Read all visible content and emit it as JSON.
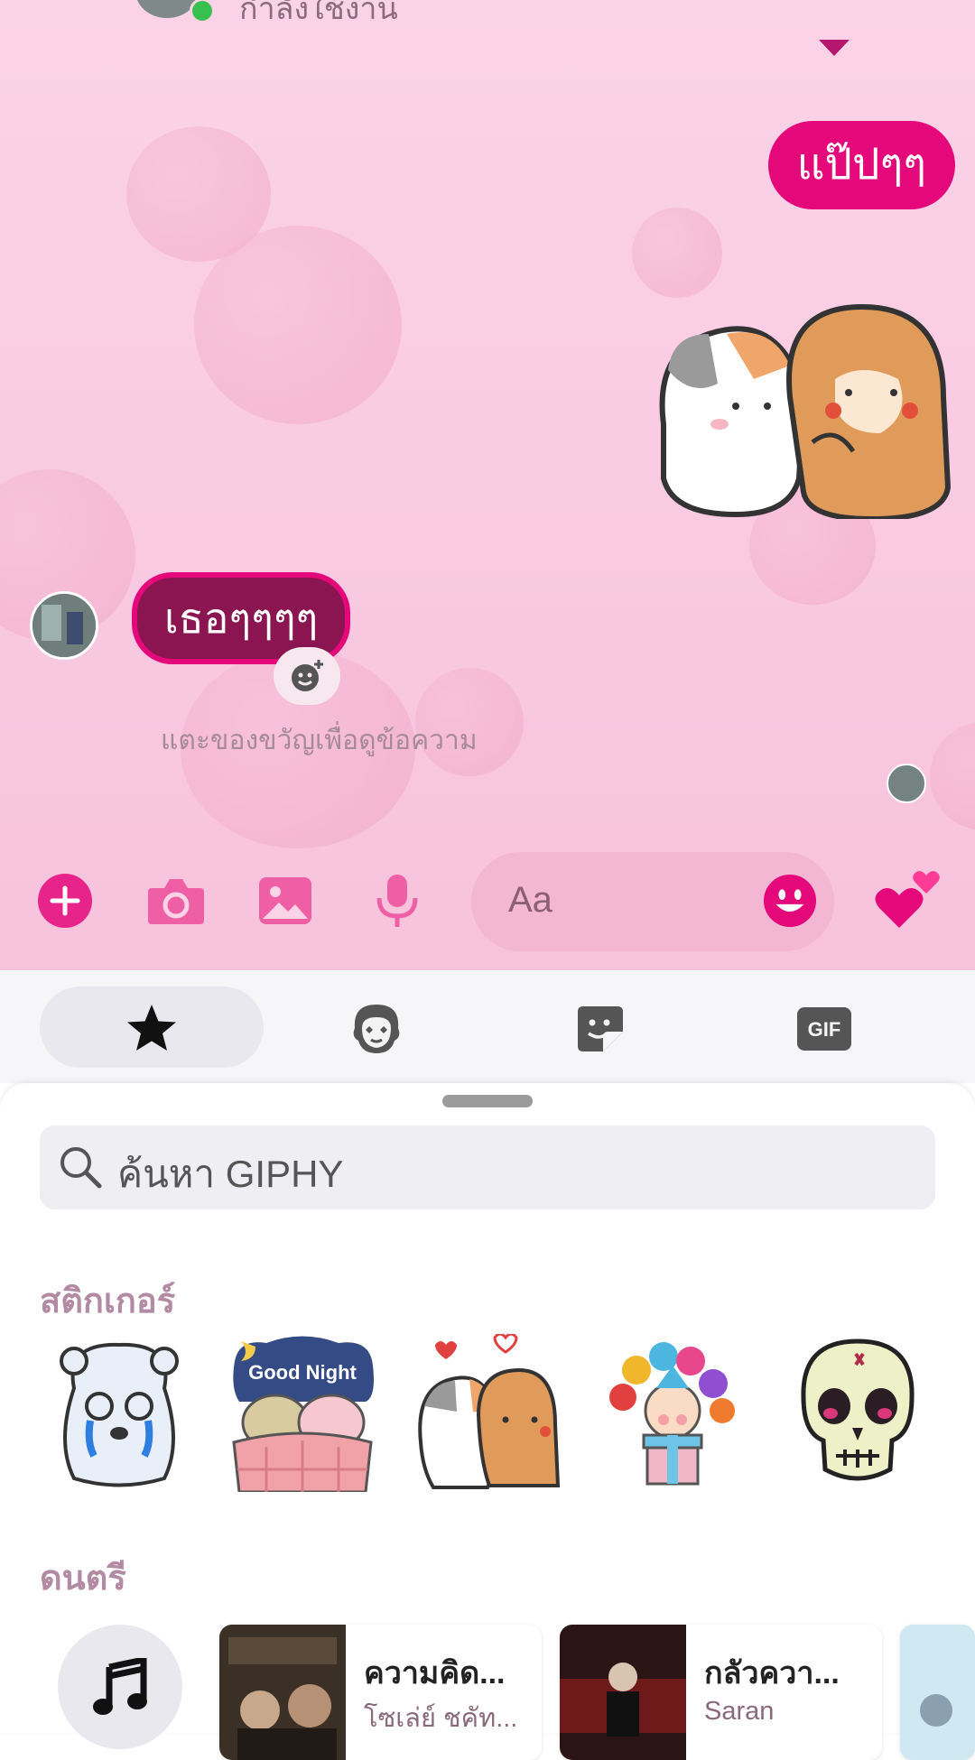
{
  "header": {
    "status_text": "กำลังใช้งาน"
  },
  "messages": {
    "outgoing_text": "แป๊ปๆๆ",
    "incoming_text": "เธอๆๆๆๆ",
    "gift_hint": "แตะของขวัญเพื่อดูข้อความ"
  },
  "composer": {
    "placeholder": "Aa",
    "icons": [
      "plus-icon",
      "camera-icon",
      "image-icon",
      "microphone-icon",
      "emoji-icon",
      "hearts-icon"
    ]
  },
  "tabs": [
    {
      "name": "tab-favorites",
      "icon": "star-icon",
      "active": true
    },
    {
      "name": "tab-avatars",
      "icon": "avatar-face-icon",
      "active": false
    },
    {
      "name": "tab-stickers",
      "icon": "sticker-icon",
      "active": false
    },
    {
      "name": "tab-gif",
      "icon": "gif-icon",
      "label": "GIF",
      "active": false
    }
  ],
  "search": {
    "placeholder": "ค้นหา GIPHY"
  },
  "sections": {
    "stickers_title": "สติกเกอร์",
    "music_title": "ดนตรี"
  },
  "stickers": [
    {
      "name": "crying-bear-sticker"
    },
    {
      "name": "good-night-sticker",
      "text": "Good Night"
    },
    {
      "name": "cat-dog-hug-sticker"
    },
    {
      "name": "balloons-gift-sticker"
    },
    {
      "name": "skull-sticker"
    }
  ],
  "music": [
    {
      "title": "ความคิด...",
      "artist": "โซเล่ย์ ชคัท..."
    },
    {
      "title": "กลัวควา...",
      "artist": "Saran"
    }
  ],
  "colors": {
    "accent": "#e5087b",
    "incoming_bubble": "#8b1550",
    "chat_bg": "#fbd3e7"
  }
}
